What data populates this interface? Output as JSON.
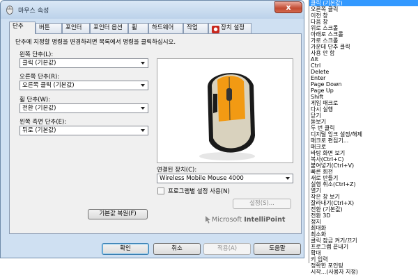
{
  "window": {
    "title": "마우스 속성",
    "close_label": "x"
  },
  "tabs": [
    "단추",
    "버튼",
    "포인터",
    "포인터 옵션",
    "휠",
    "하드웨어",
    "작업",
    "장치 설정"
  ],
  "panel": {
    "instruction": "단추에 지정할 명령을 변경하려면 목록에서 명령을 클릭하십시오.",
    "fields": [
      {
        "label": "왼쪽 단추(L):",
        "value": "클릭 (기본값)"
      },
      {
        "label": "오른쪽 단추(R):",
        "value": "오른쪽 클릭 (기본값)"
      },
      {
        "label": "휠 단추(W):",
        "value": "전환 (기본값)"
      },
      {
        "label": "왼쪽 측면 단추(E):",
        "value": "뒤로 (기본값)"
      }
    ],
    "restore_button": "기본값 복원(F)",
    "connected_device_label": "연결된 장치(C):",
    "connected_device_value": "Wireless Mobile Mouse 4000",
    "program_settings_label": "프로그램별 설정 사용(N)",
    "program_settings_checked": false,
    "settings_button": "설정(S)...",
    "brand": {
      "prefix": "Microsoft ",
      "name": "IntelliPoint"
    },
    "mouse_accent_color": "#f29a13"
  },
  "footer": {
    "ok": "확인",
    "cancel": "취소",
    "apply": "적용(A)",
    "help": "도움말"
  },
  "command_list": {
    "selected_index": 0,
    "items": [
      "클릭 (기본값)",
      "오른쪽 클릭",
      "이전 창",
      "다음 창",
      "위로 스크롤",
      "아래로 스크롤",
      "가로 스크롤",
      "가운데 단추 클릭",
      "사용 안 함",
      "Alt",
      "Ctrl",
      "Delete",
      "Enter",
      "Page Down",
      "Page Up",
      "Shift",
      "게임 매크로",
      "다시 실행",
      "닫기",
      "돋보기",
      "두 번 클릭",
      "디지털 잉크 설정/해제",
      "매크로 편집기...",
      "매크로",
      "바탕 화면 보기",
      "복사(Ctrl+C)",
      "붙여넣기(Ctrl+V)",
      "빠른 회전",
      "새로 만들기",
      "실행 취소(Ctrl+Z)",
      "열기",
      "작은 창 보기",
      "잘라내기(Ctrl+X)",
      "전환 (기본값)",
      "전환 3D",
      "정지",
      "최대화",
      "최소화",
      "클릭 잠금 켜기/끄기",
      "프로그램 끝내기",
      "확대",
      "키 입력",
      "정확한 포인팅",
      "시작...(사용자 지정)"
    ]
  }
}
